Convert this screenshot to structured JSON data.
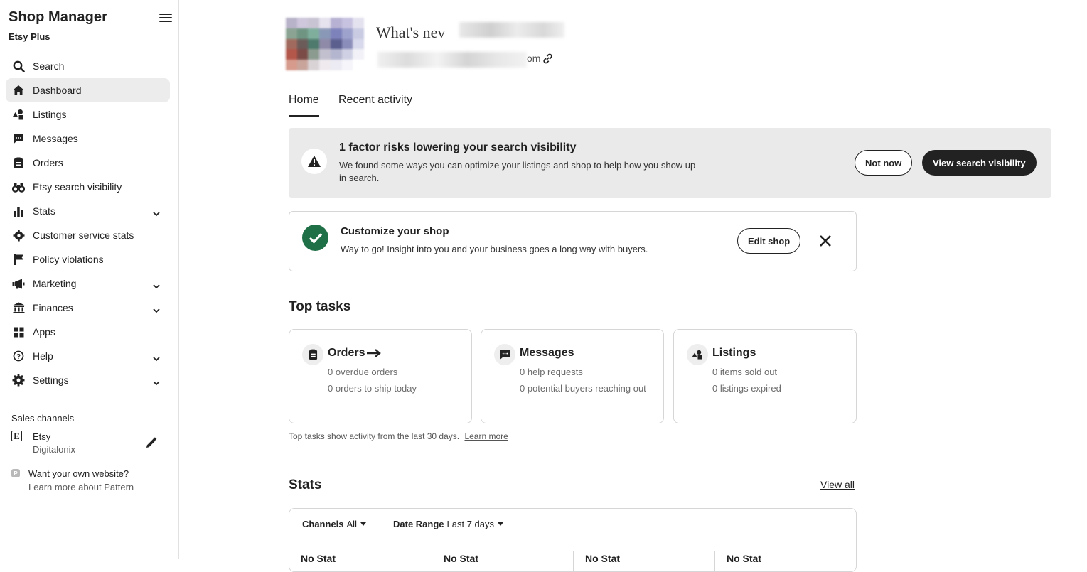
{
  "sidebar": {
    "title": "Shop Manager",
    "subtitle": "Etsy Plus",
    "items": [
      {
        "label": "Search",
        "icon": "search-icon"
      },
      {
        "label": "Dashboard",
        "icon": "home-icon",
        "active": true
      },
      {
        "label": "Listings",
        "icon": "listings-icon"
      },
      {
        "label": "Messages",
        "icon": "messages-icon"
      },
      {
        "label": "Orders",
        "icon": "orders-icon"
      },
      {
        "label": "Etsy search visibility",
        "icon": "binoculars-icon"
      },
      {
        "label": "Stats",
        "icon": "stats-icon",
        "expandable": true
      },
      {
        "label": "Customer service stats",
        "icon": "gear-badge-icon"
      },
      {
        "label": "Policy violations",
        "icon": "flag-icon"
      },
      {
        "label": "Marketing",
        "icon": "megaphone-icon",
        "expandable": true
      },
      {
        "label": "Finances",
        "icon": "bank-icon",
        "expandable": true
      },
      {
        "label": "Apps",
        "icon": "apps-grid-icon"
      },
      {
        "label": "Help",
        "icon": "help-icon",
        "expandable": true
      },
      {
        "label": "Settings",
        "icon": "settings-gear-icon",
        "expandable": true
      }
    ],
    "sales_channels": {
      "title": "Sales channels",
      "etsy_logo": "E",
      "channel_name": "Etsy",
      "shop_name": "Digitalonix"
    },
    "pattern": {
      "logo": "P",
      "question": "Want your own website?",
      "link": "Learn more about Pattern"
    }
  },
  "header": {
    "shop_title": "What's nev",
    "url_tail": "om"
  },
  "tabs": [
    {
      "label": "Home",
      "active": true
    },
    {
      "label": "Recent activity",
      "active": false
    }
  ],
  "alert": {
    "title": "1 factor risks lowering your search visibility",
    "body": "We found some ways you can optimize your listings and shop to help how you show up in search.",
    "secondary_button": "Not now",
    "primary_button": "View search visibility"
  },
  "customize": {
    "title": "Customize your shop",
    "body": "Way to go! Insight into you and your business goes a long way with buyers.",
    "button": "Edit shop"
  },
  "top_tasks": {
    "title": "Top tasks",
    "cards": [
      {
        "title": "Orders",
        "icon": "orders-icon",
        "arrow": "→",
        "lines": [
          "0 overdue orders",
          "0 orders to ship today"
        ]
      },
      {
        "title": "Messages",
        "icon": "messages-icon",
        "lines": [
          "0 help requests",
          "0 potential buyers reaching out"
        ]
      },
      {
        "title": "Listings",
        "icon": "listings-icon",
        "lines": [
          "0 items sold out",
          "0 listings expired"
        ]
      }
    ],
    "note": "Top tasks show activity from the last 30 days.",
    "note_link": "Learn more"
  },
  "stats": {
    "title": "Stats",
    "view_all": "View all",
    "channels_label": "Channels",
    "channels_value": "All",
    "date_label": "Date Range",
    "date_value": "Last 7 days",
    "cells": [
      "No Stat",
      "No Stat",
      "No Stat",
      "No Stat"
    ]
  },
  "colors": {
    "accent_dark": "#222222",
    "success_green": "#1f6f47",
    "alert_bg": "#eaeaea",
    "active_nav_bg": "#ececec"
  }
}
